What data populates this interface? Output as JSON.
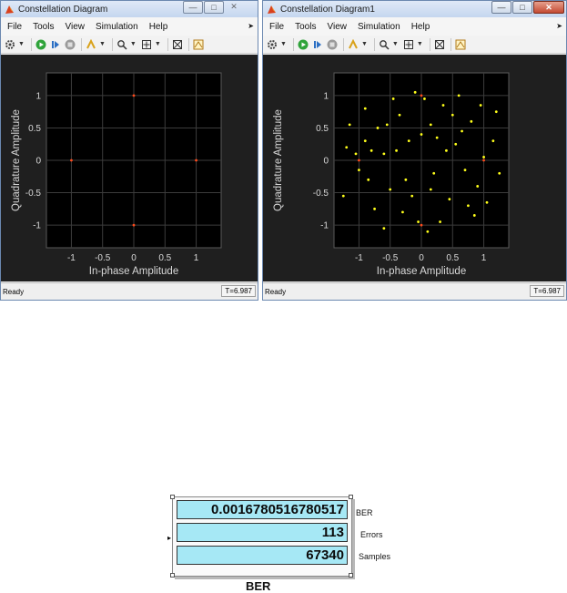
{
  "windows": [
    {
      "title": "Constellation Diagram",
      "menu": [
        "File",
        "Tools",
        "View",
        "Simulation",
        "Help"
      ],
      "status": "Ready",
      "time": "T=6.987",
      "xlabel": "In-phase Amplitude",
      "ylabel": "Quadrature Amplitude",
      "xticks": [
        "-1",
        "-0.5",
        "0",
        "0.5",
        "1"
      ],
      "yticks": [
        "1",
        "0.5",
        "0",
        "-0.5",
        "-1"
      ]
    },
    {
      "title": "Constellation Diagram1",
      "menu": [
        "File",
        "Tools",
        "View",
        "Simulation",
        "Help"
      ],
      "status": "Ready",
      "time": "T=6.987",
      "xlabel": "In-phase Amplitude",
      "ylabel": "Quadrature Amplitude",
      "xticks": [
        "-1",
        "-0.5",
        "0",
        "0.5",
        "1"
      ],
      "yticks": [
        "1",
        "0.5",
        "0",
        "-0.5",
        "-1"
      ]
    }
  ],
  "chart_data": [
    {
      "type": "scatter",
      "xlabel": "In-phase Amplitude",
      "ylabel": "Quadrature Amplitude",
      "xlim": [
        -1.4,
        1.4
      ],
      "ylim": [
        -1.35,
        1.35
      ],
      "grid": true,
      "series": [
        {
          "color": "#ff4a1c",
          "points": [
            [
              -1,
              0
            ],
            [
              1,
              0
            ],
            [
              0,
              1
            ],
            [
              0,
              -1
            ]
          ]
        }
      ]
    },
    {
      "type": "scatter",
      "xlabel": "In-phase Amplitude",
      "ylabel": "Quadrature Amplitude",
      "xlim": [
        -1.4,
        1.4
      ],
      "ylim": [
        -1.35,
        1.35
      ],
      "grid": true,
      "series": [
        {
          "color": "#ffff1a",
          "points": [
            [
              -1.2,
              0.2
            ],
            [
              -1.05,
              0.1
            ],
            [
              -0.9,
              0.3
            ],
            [
              -1.0,
              -0.15
            ],
            [
              -0.85,
              -0.3
            ],
            [
              -0.7,
              0.5
            ],
            [
              -0.6,
              0.1
            ],
            [
              -0.5,
              -0.45
            ],
            [
              -0.35,
              0.7
            ],
            [
              -0.3,
              -0.8
            ],
            [
              -0.2,
              0.3
            ],
            [
              -0.1,
              1.05
            ],
            [
              0.05,
              0.95
            ],
            [
              0.15,
              0.55
            ],
            [
              0.2,
              -0.2
            ],
            [
              0.1,
              -1.1
            ],
            [
              -0.05,
              -0.95
            ],
            [
              0.35,
              0.85
            ],
            [
              0.45,
              -0.6
            ],
            [
              0.55,
              0.25
            ],
            [
              0.7,
              -0.15
            ],
            [
              0.8,
              0.6
            ],
            [
              0.9,
              -0.4
            ],
            [
              1.0,
              0.05
            ],
            [
              1.15,
              0.3
            ],
            [
              1.25,
              -0.2
            ],
            [
              0.95,
              0.85
            ],
            [
              -0.75,
              -0.75
            ],
            [
              -1.15,
              0.55
            ],
            [
              0.6,
              1.0
            ],
            [
              -0.45,
              0.95
            ],
            [
              0.3,
              -0.95
            ],
            [
              0.85,
              -0.85
            ],
            [
              -0.9,
              0.8
            ],
            [
              -0.25,
              -0.3
            ],
            [
              0.4,
              0.15
            ],
            [
              -0.6,
              -1.05
            ],
            [
              1.2,
              0.75
            ],
            [
              -1.25,
              -0.55
            ],
            [
              0.0,
              0.4
            ],
            [
              0.25,
              0.35
            ],
            [
              -0.15,
              -0.55
            ],
            [
              0.65,
              0.45
            ],
            [
              -0.4,
              0.15
            ],
            [
              0.75,
              -0.7
            ],
            [
              1.05,
              -0.65
            ],
            [
              -0.8,
              0.15
            ],
            [
              0.5,
              0.7
            ],
            [
              -0.55,
              0.55
            ],
            [
              0.15,
              -0.45
            ]
          ]
        },
        {
          "color": "#ff4a1c",
          "points": [
            [
              -1,
              0
            ],
            [
              1,
              0
            ],
            [
              0,
              1
            ],
            [
              0,
              -1
            ]
          ]
        }
      ]
    }
  ],
  "block": {
    "displays": [
      "0.0016780516780517",
      "113",
      "67340"
    ],
    "ports": [
      "BER",
      "Errors",
      "Samples"
    ],
    "name": "BER"
  }
}
